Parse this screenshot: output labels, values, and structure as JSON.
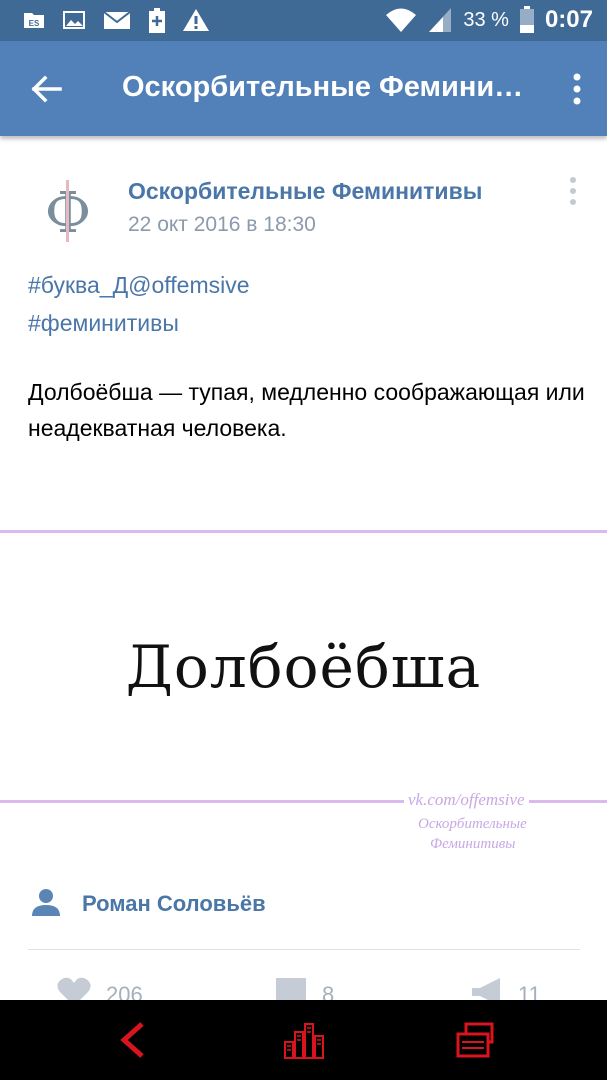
{
  "status_bar": {
    "battery_percent": "33 %",
    "time": "0:07",
    "icons": [
      "es-file-icon",
      "image-icon",
      "mail-icon",
      "battery-plus-icon",
      "warning-icon",
      "wifi-icon",
      "signal-icon",
      "battery-icon"
    ]
  },
  "app_bar": {
    "title": "Оскорбительные Феминит…",
    "back_icon": "arrow-left-icon",
    "more_icon": "more-vertical-icon"
  },
  "post": {
    "author": "Оскорбительные Феминитивы",
    "date": "22 окт 2016 в 18:30",
    "avatar_letter": "Ф",
    "hashtags": [
      "#буква_Д@offemsive",
      "#феминитивы"
    ],
    "text": "Долбоёбша — тупая, медленно соображающая или неадекватная человека.",
    "image": {
      "word": "Долбоёбша",
      "watermark_url": "vk.com/offemsive",
      "watermark_line1": "Оскорбительные",
      "watermark_line2": "Феминитивы"
    },
    "signer": "Роман Соловьёв",
    "likes": "206",
    "comments": "8",
    "reposts": "11"
  },
  "colors": {
    "status_bar": "#3f6a96",
    "app_bar": "#5181b8",
    "link": "#4a76a8",
    "nav_accent": "#d8141e",
    "image_line": "#d9b9ef"
  },
  "nav_bar": {
    "icons": [
      "nav-back-icon",
      "nav-home-icon",
      "nav-recents-icon"
    ]
  }
}
